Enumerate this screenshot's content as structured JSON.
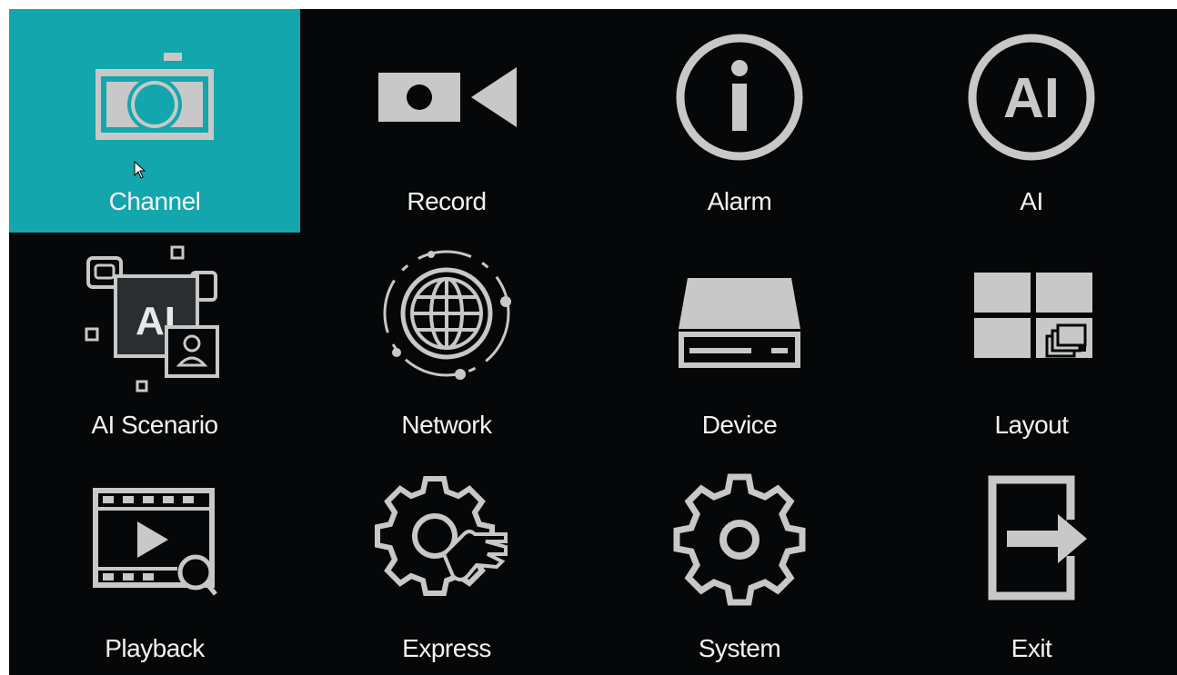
{
  "menu": {
    "selected": "Channel",
    "accent_color": "#14a6ad",
    "background_color": "#050708",
    "icon_color": "#c8c8c8",
    "items": [
      {
        "label": "Channel",
        "icon": "camera-icon"
      },
      {
        "label": "Record",
        "icon": "video-camera-icon"
      },
      {
        "label": "Alarm",
        "icon": "info-circle-icon"
      },
      {
        "label": "AI",
        "icon": "ai-circle-icon"
      },
      {
        "label": "AI Scenario",
        "icon": "ai-scenario-icon"
      },
      {
        "label": "Network",
        "icon": "globe-network-icon"
      },
      {
        "label": "Device",
        "icon": "hard-drive-icon"
      },
      {
        "label": "Layout",
        "icon": "layout-grid-icon"
      },
      {
        "label": "Playback",
        "icon": "video-search-icon"
      },
      {
        "label": "Express",
        "icon": "gear-touch-icon"
      },
      {
        "label": "System",
        "icon": "gear-icon"
      },
      {
        "label": "Exit",
        "icon": "exit-door-icon"
      }
    ],
    "icon_text": {
      "ai": "AI",
      "ai_scenario": "AI"
    }
  }
}
